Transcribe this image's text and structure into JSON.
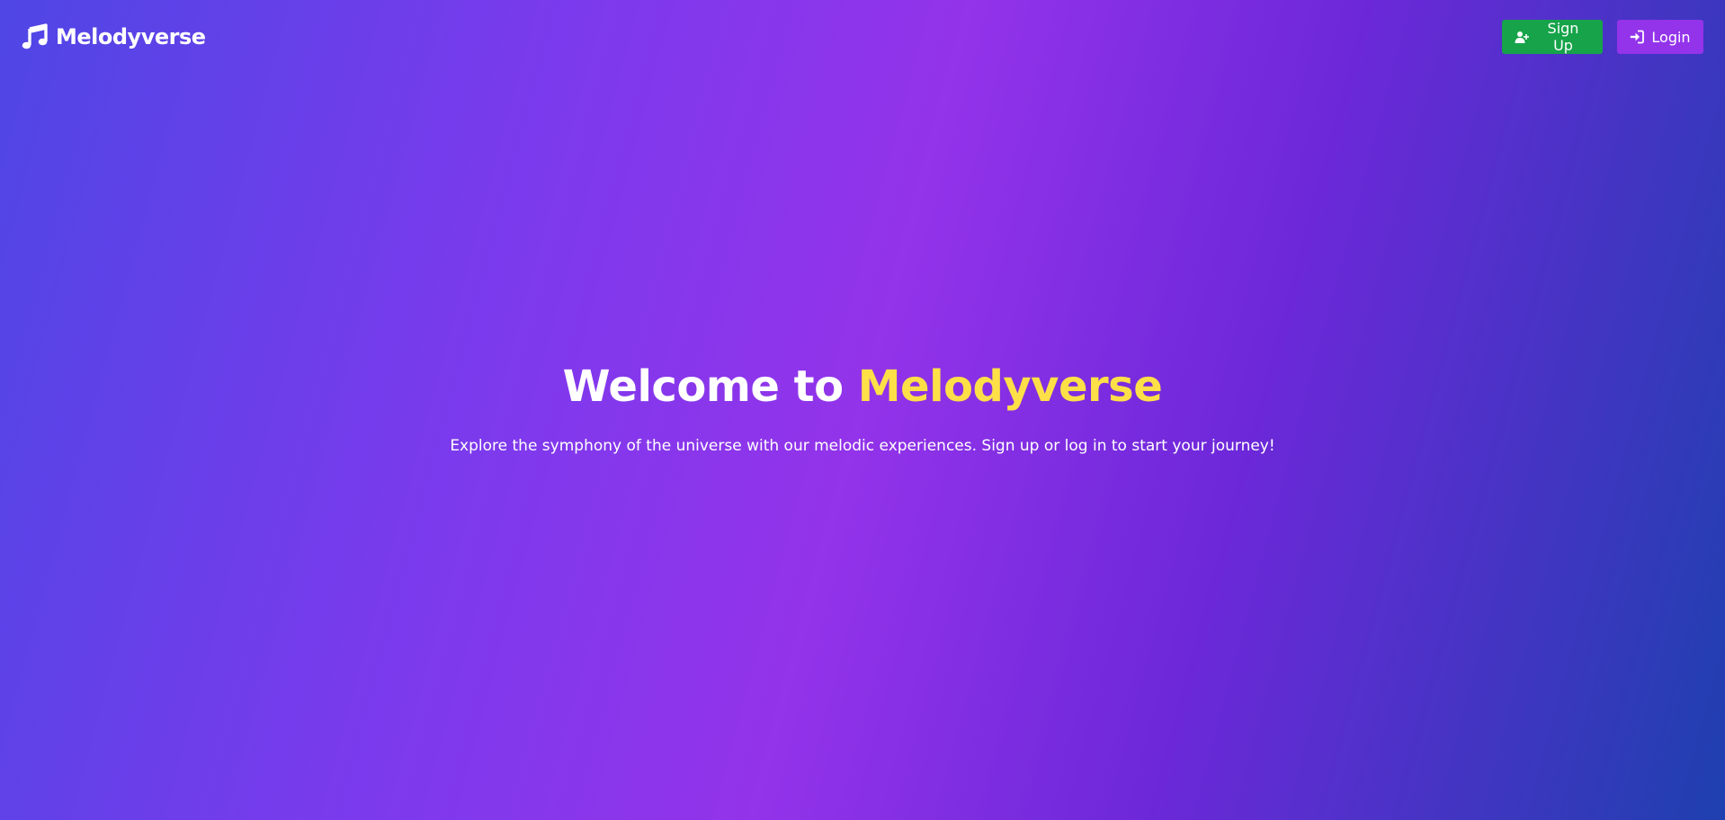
{
  "header": {
    "brand_icon": "music-note-icon",
    "brand_name": "Melodyverse",
    "signup_label": "Sign Up",
    "signup_icon": "user-plus-icon",
    "login_label": "Login",
    "login_icon": "sign-in-icon"
  },
  "hero": {
    "title_prefix": "Welcome to ",
    "title_accent": "Melodyverse",
    "subtitle": "Explore the symphony of the universe with our melodic experiences. Sign up or log in to start your journey!"
  },
  "colors": {
    "gradient_start": "#4f46e5",
    "gradient_mid": "#9333ea",
    "gradient_end": "#1e40af",
    "accent_yellow": "#fde047",
    "signup_green": "#16a34a",
    "login_purple": "#9333ea"
  }
}
